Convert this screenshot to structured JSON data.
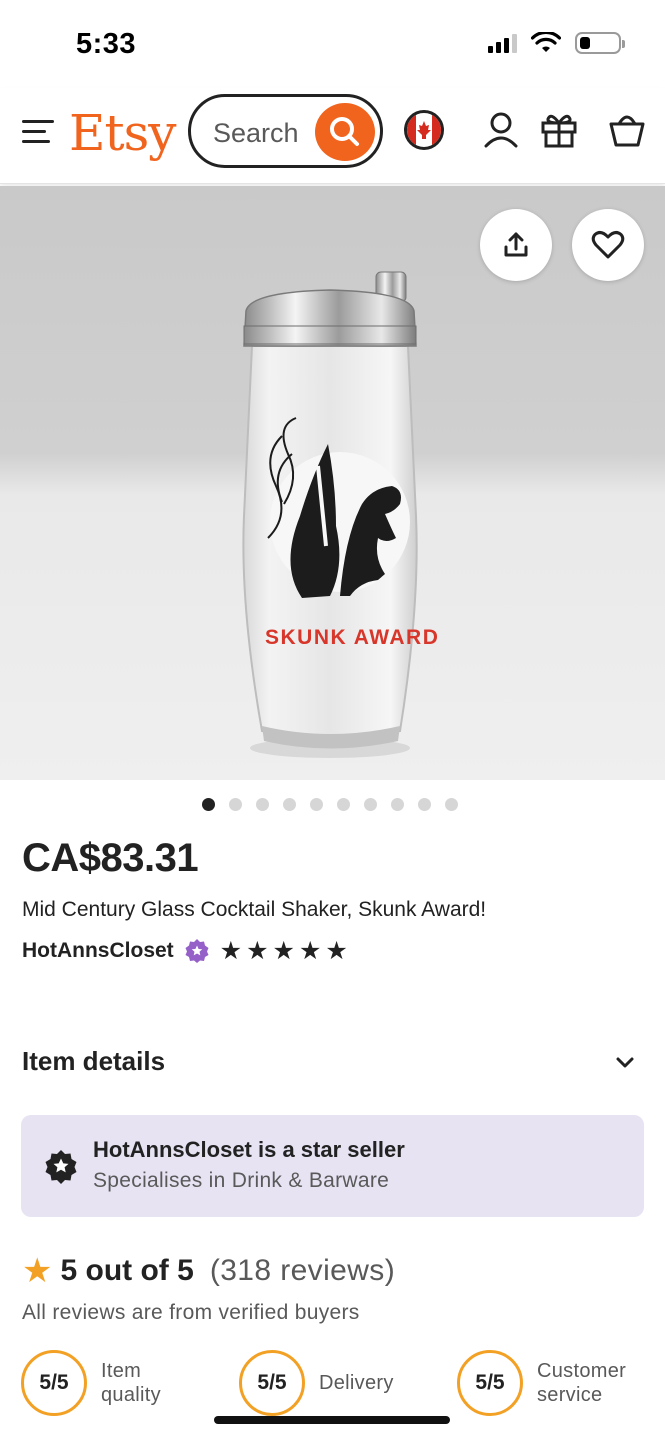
{
  "status_bar": {
    "time": "5:33",
    "battery_level": 0.28
  },
  "header": {
    "logo": "Etsy",
    "search_placeholder": "Search",
    "brand_color": "#f1641e"
  },
  "hero": {
    "gallery_count": 10,
    "gallery_active_index": 0,
    "shaker_text": "SKUNK AWARD"
  },
  "listing": {
    "price": "CA$83.31",
    "title": "Mid Century Glass Cocktail Shaker, Skunk Award!",
    "shop_name": "HotAnnsCloset",
    "shop_rating_stars": 5
  },
  "item_details": {
    "label": "Item details"
  },
  "star_seller": {
    "title": "HotAnnsCloset is a star seller",
    "subtitle": "Specialises in Drink & Barware",
    "accent_bg": "#e7e3f3"
  },
  "reviews": {
    "rating_text": "5 out of 5",
    "review_count": "(318 reviews)",
    "verified_note": "All reviews are from verified buyers",
    "star_color": "#f2a125",
    "metrics": [
      {
        "score": "5/5",
        "label_line1": "Item",
        "label_line2": "quality"
      },
      {
        "score": "5/5",
        "label_line1": "Delivery",
        "label_line2": ""
      },
      {
        "score": "5/5",
        "label_line1": "Customer",
        "label_line2": "service"
      }
    ]
  }
}
